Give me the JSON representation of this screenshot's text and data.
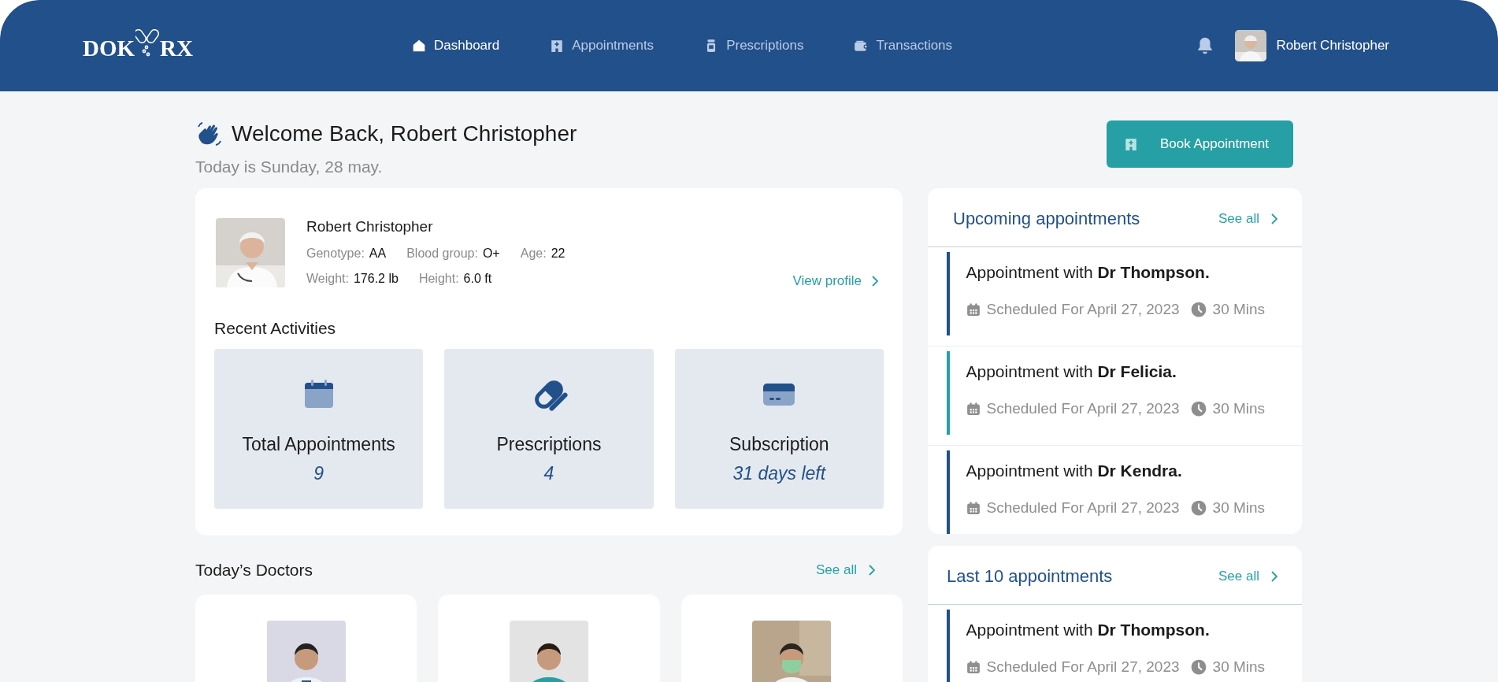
{
  "brand": {
    "left": "DOK",
    "right": "RX"
  },
  "nav": [
    {
      "label": "Dashboard",
      "selected": true
    },
    {
      "label": "Appointments",
      "selected": false
    },
    {
      "label": "Prescriptions",
      "selected": false
    },
    {
      "label": "Transactions",
      "selected": false
    }
  ],
  "user": {
    "name": "Robert Christopher"
  },
  "welcome": {
    "title": "Welcome Back, Robert Christopher",
    "date": "Today is Sunday, 28 may."
  },
  "book_button": "Book Appointment",
  "profile": {
    "name": "Robert Christopher",
    "fields": [
      {
        "label": "Genotype:",
        "value": "AA"
      },
      {
        "label": "Blood group:",
        "value": "O+"
      },
      {
        "label": "Age:",
        "value": "22"
      },
      {
        "label": "Weight:",
        "value": "176.2 lb"
      },
      {
        "label": "Height:",
        "value": "6.0 ft"
      }
    ],
    "link": "View profile"
  },
  "recent": {
    "title": "Recent Activities",
    "tiles": [
      {
        "label": "Total Appointments",
        "value": "9"
      },
      {
        "label": "Prescriptions",
        "value": "4"
      },
      {
        "label": "Subscription",
        "value": "31 days left"
      }
    ]
  },
  "doctors": {
    "title": "Today’s Doctors",
    "see_all": "See all"
  },
  "panels": [
    {
      "title": "Upcoming appointments",
      "see_all": "See all",
      "items": [
        {
          "text": "Appointment with **Dr Thompson.**",
          "color": "#22508a",
          "date": "Scheduled For April 27, 2023",
          "duration": "30 Mins"
        },
        {
          "text": "Appointment with **Dr Felicia.**",
          "color": "#26a0a5",
          "date": "Scheduled For April 27, 2023",
          "duration": "30 Mins"
        },
        {
          "text": "Appointment with **Dr Kendra.**",
          "color": "#22508a",
          "date": "Scheduled For April 27, 2023",
          "duration": "30 Mins"
        }
      ]
    },
    {
      "title": "Last 10 appointments",
      "see_all": "See all",
      "items": [
        {
          "text": "Appointment with **Dr Thompson.**",
          "color": "#22508a",
          "date": "Scheduled For April 27, 2023",
          "duration": "30 Mins"
        }
      ]
    }
  ]
}
